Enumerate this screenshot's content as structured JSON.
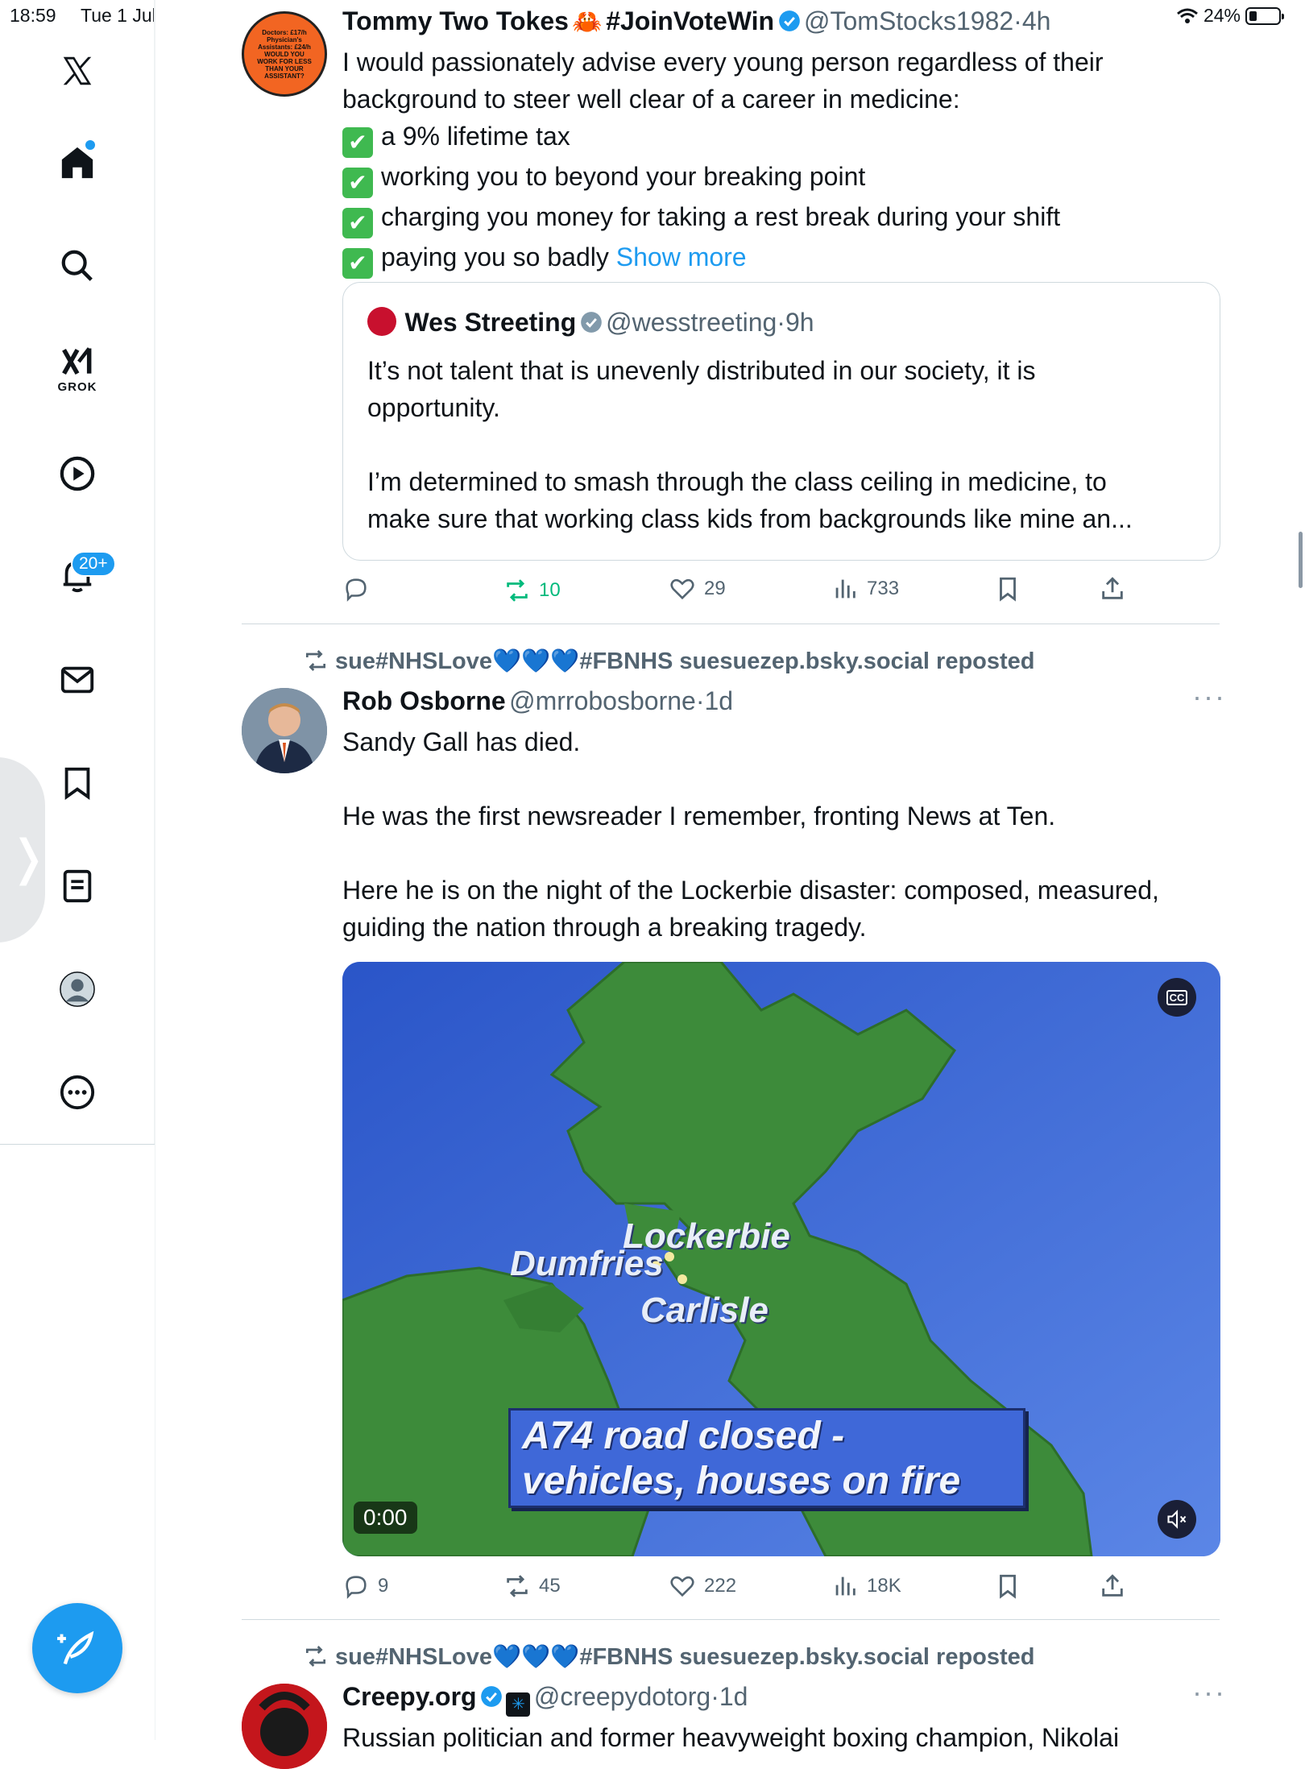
{
  "status_bar": {
    "time": "18:59",
    "date": "Tue 1 Jul",
    "battery": "24%"
  },
  "sidebar": {
    "grok_label": "GROK",
    "notifications_badge": "20+"
  },
  "tweet1": {
    "avatar_text": "Doctors: £17/h Physician's Assistants: £24/h WOULD YOU WORK FOR LESS THAN YOUR ASSISTANT?",
    "name": "Tommy Two Tokes",
    "name_emoji": "🦀",
    "name_tag": "#JoinVoteWin",
    "handle": "@TomStocks1982",
    "time": "4h",
    "intro_line1": "I would passionately advise every young person regardless of their",
    "intro_line2": "background to steer well clear of a career in medicine:",
    "bullets": [
      "a 9% lifetime tax",
      "working you to beyond your breaking point",
      "charging you money for taking a rest break during your shift",
      "paying you so badly"
    ],
    "show_more": "Show more",
    "quote": {
      "name": "Wes Streeting",
      "handle": "@wesstreeting",
      "time": "9h",
      "line1": "It’s not talent that is unevenly distributed in our society, it is",
      "line2": "opportunity.",
      "line3": "I’m determined to smash through the class ceiling in medicine, to",
      "line4": "make sure that working class kids from backgrounds like mine an..."
    },
    "reposts": "10",
    "likes": "29",
    "views": "733"
  },
  "tweet2": {
    "repost_by": "sue#NHSLove💙💙💙#FBNHS suesuezep.bsky.social reposted",
    "name": "Rob Osborne",
    "handle": "@mrrobosborne",
    "time": "1d",
    "line1": "Sandy Gall has died.",
    "line2": "He was the first newsreader I remember, fronting News at Ten.",
    "line3": "Here he is on the night of the Lockerbie disaster: composed, measured,",
    "line4": "guiding the nation through a breaking tragedy.",
    "video": {
      "cc": "CC",
      "label_lockerbie": "Lockerbie",
      "label_dumfries": "Dumfries",
      "label_carlisle": "Carlisle",
      "caption_line1": "A74 road closed -",
      "caption_line2": "vehicles, houses on fire",
      "timestamp": "0:00"
    },
    "replies": "9",
    "reposts": "45",
    "likes": "222",
    "views": "18K"
  },
  "tweet3": {
    "repost_by": "sue#NHSLove💙💙💙#FBNHS suesuezep.bsky.social reposted",
    "name": "Creepy.org",
    "handle": "@creepydotorg",
    "time": "1d",
    "line1": "Russian politician and former heavyweight boxing champion, Nikolai"
  },
  "colors": {
    "accent": "#1d9bf0",
    "repost_green": "#00ba7c",
    "muted": "#536471"
  }
}
